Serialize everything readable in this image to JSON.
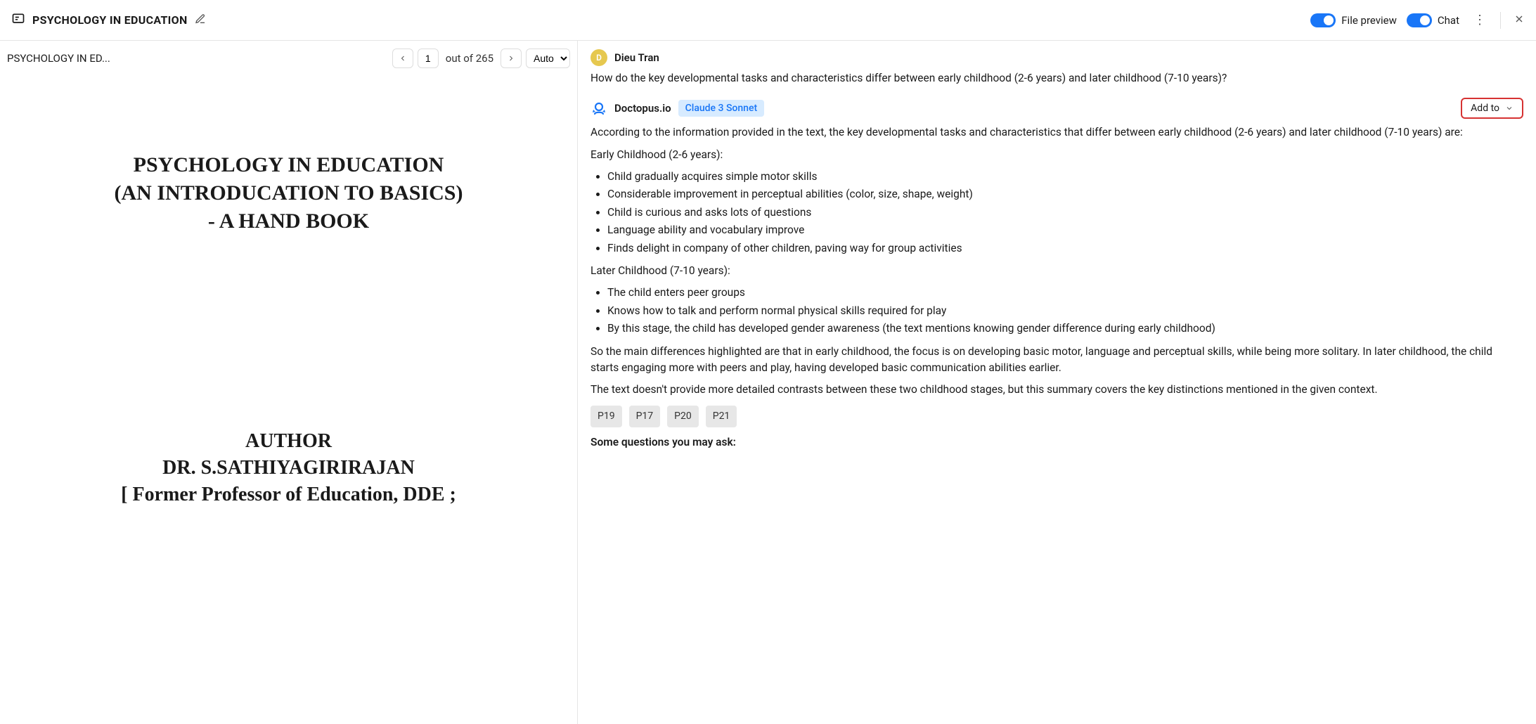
{
  "header": {
    "title": "PSYCHOLOGY IN EDUCATION",
    "file_preview_label": "File preview",
    "chat_label": "Chat"
  },
  "preview": {
    "title_truncated": "PSYCHOLOGY IN ED...",
    "page_current": "1",
    "page_total_label": "out of 265",
    "zoom_option": "Auto"
  },
  "document": {
    "line1": "PSYCHOLOGY IN EDUCATION",
    "line2": "(AN INTRODUCATION TO BASICS)",
    "line3": "-  A HAND BOOK",
    "author_label": "AUTHOR",
    "author_name": "DR. S.SATHIYAGIRIRAJAN",
    "author_title": "[ Former Professor of Education, DDE ;"
  },
  "chat": {
    "user": {
      "initial": "D",
      "name": "Dieu Tran",
      "question": "How do the key developmental tasks and characteristics differ between early childhood (2-6 years) and later childhood (7-10 years)?"
    },
    "bot": {
      "name": "Doctopus.io",
      "model": "Claude 3 Sonnet",
      "add_to_label": "Add to",
      "intro": "According to the information provided in the text, the key developmental tasks and characteristics that differ between early childhood (2-6 years) and later childhood (7-10 years) are:",
      "early_label": "Early Childhood (2-6 years):",
      "early_items": [
        "Child gradually acquires simple motor skills",
        "Considerable improvement in perceptual abilities (color, size, shape, weight)",
        "Child is curious and asks lots of questions",
        "Language ability and vocabulary improve",
        "Finds delight in company of other children, paving way for group activities"
      ],
      "later_label": "Later Childhood (7-10 years):",
      "later_items": [
        "The child enters peer groups",
        "Knows how to talk and perform normal physical skills required for play",
        "By this stage, the child has developed gender awareness (the text mentions knowing gender difference during early childhood)"
      ],
      "summary1": "So the main differences highlighted are that in early childhood, the focus is on developing basic motor, language and perceptual skills, while being more solitary. In later childhood, the child starts engaging more with peers and play, having developed basic communication abilities earlier.",
      "summary2": "The text doesn't provide more detailed contrasts between these two childhood stages, but this summary covers the key distinctions mentioned in the given context.",
      "page_tags": [
        "P19",
        "P17",
        "P20",
        "P21"
      ],
      "followup_label": "Some questions you may ask:"
    }
  }
}
